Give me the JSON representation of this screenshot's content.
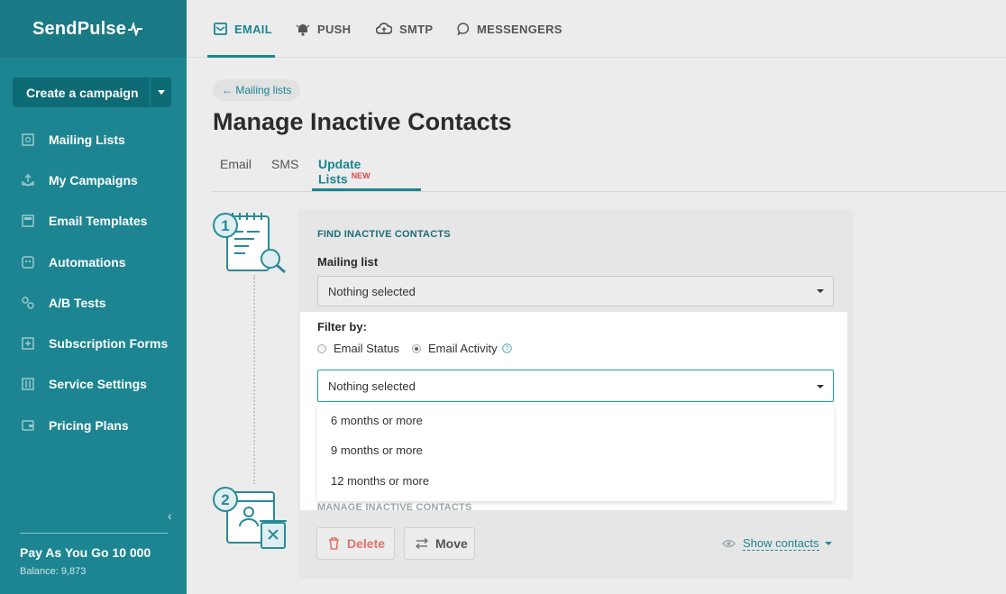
{
  "brand": {
    "name": "SendPulse",
    "accent": "#1c8591"
  },
  "sidebar": {
    "create_label": "Create a campaign",
    "items": [
      {
        "label": "Mailing Lists",
        "icon": "mailing-list-icon"
      },
      {
        "label": "My Campaigns",
        "icon": "campaign-icon"
      },
      {
        "label": "Email Templates",
        "icon": "template-icon"
      },
      {
        "label": "Automations",
        "icon": "automation-icon"
      },
      {
        "label": "A/B Tests",
        "icon": "ab-test-icon"
      },
      {
        "label": "Subscription Forms",
        "icon": "form-icon"
      },
      {
        "label": "Service Settings",
        "icon": "settings-icon"
      },
      {
        "label": "Pricing Plans",
        "icon": "wallet-icon"
      }
    ],
    "plan_name": "Pay As You Go 10 000",
    "balance": "Balance: 9,873"
  },
  "topnav": {
    "tabs": [
      {
        "label": "EMAIL",
        "icon": "email-icon"
      },
      {
        "label": "PUSH",
        "icon": "bell-icon"
      },
      {
        "label": "SMTP",
        "icon": "cloud-icon"
      },
      {
        "label": "MESSENGERS",
        "icon": "chat-icon"
      }
    ]
  },
  "page": {
    "breadcrumb": "← Mailing lists",
    "title": "Manage Inactive Contacts",
    "subtabs": [
      {
        "label": "Email"
      },
      {
        "label": "SMS"
      },
      {
        "label": "Update Lists",
        "badge": "NEW"
      }
    ]
  },
  "step1": {
    "number": "1",
    "section_title": "FIND INACTIVE CONTACTS",
    "mailing_list_label": "Mailing list",
    "mailing_list_value": "Nothing selected",
    "filter_label": "Filter by:",
    "radio_options": [
      {
        "label": "Email Status",
        "selected": false
      },
      {
        "label": "Email Activity",
        "selected": true
      }
    ],
    "activity_select_value": "Nothing selected",
    "activity_options": [
      "6 months or more",
      "9 months or more",
      "12 months or more"
    ]
  },
  "step2": {
    "number": "2",
    "section_title": "MANAGE INACTIVE CONTACTS",
    "delete_label": "Delete",
    "move_label": "Move",
    "show_contacts_label": "Show contacts"
  }
}
